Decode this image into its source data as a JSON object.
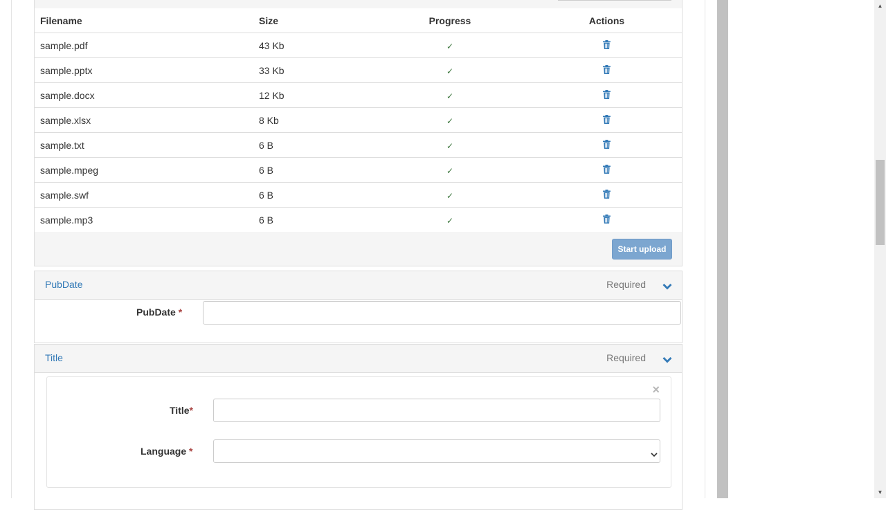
{
  "upload_table": {
    "headers": {
      "filename": "Filename",
      "size": "Size",
      "progress": "Progress",
      "actions": "Actions"
    },
    "rows": [
      {
        "filename": "sample.pdf",
        "size": "43 Kb",
        "progress": "✓"
      },
      {
        "filename": "sample.pptx",
        "size": "33 Kb",
        "progress": "✓"
      },
      {
        "filename": "sample.docx",
        "size": "12 Kb",
        "progress": "✓"
      },
      {
        "filename": "sample.xlsx",
        "size": "8 Kb",
        "progress": "✓"
      },
      {
        "filename": "sample.txt",
        "size": "6 B",
        "progress": "✓"
      },
      {
        "filename": "sample.mpeg",
        "size": "6 B",
        "progress": "✓"
      },
      {
        "filename": "sample.swf",
        "size": "6 B",
        "progress": "✓"
      },
      {
        "filename": "sample.mp3",
        "size": "6 B",
        "progress": "✓"
      }
    ],
    "delete_icon": "trash-icon",
    "start_upload_label": "Start upload"
  },
  "pubdate_section": {
    "title": "PubDate",
    "status": "Required",
    "field_label": "PubDate",
    "required_mark": "*",
    "value": ""
  },
  "title_section": {
    "title": "Title",
    "status": "Required",
    "remove_label": "×",
    "title_label": "Title",
    "title_required_mark": "*",
    "title_value": "",
    "language_label": "Language",
    "language_required_mark": "*",
    "language_value": ""
  },
  "colors": {
    "link": "#337ab7",
    "success": "#3c763d",
    "required": "#a94442",
    "button": "#7ca6d0"
  }
}
